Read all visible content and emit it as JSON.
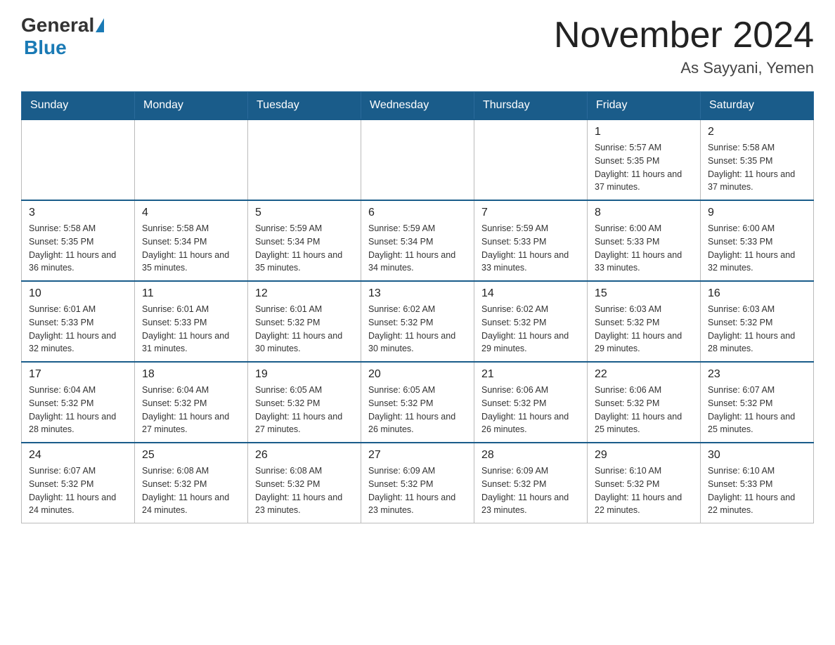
{
  "header": {
    "logo_general": "General",
    "logo_blue": "Blue",
    "month_title": "November 2024",
    "location": "As Sayyani, Yemen"
  },
  "days_of_week": [
    "Sunday",
    "Monday",
    "Tuesday",
    "Wednesday",
    "Thursday",
    "Friday",
    "Saturday"
  ],
  "weeks": [
    {
      "days": [
        {
          "num": "",
          "info": ""
        },
        {
          "num": "",
          "info": ""
        },
        {
          "num": "",
          "info": ""
        },
        {
          "num": "",
          "info": ""
        },
        {
          "num": "",
          "info": ""
        },
        {
          "num": "1",
          "info": "Sunrise: 5:57 AM\nSunset: 5:35 PM\nDaylight: 11 hours and 37 minutes."
        },
        {
          "num": "2",
          "info": "Sunrise: 5:58 AM\nSunset: 5:35 PM\nDaylight: 11 hours and 37 minutes."
        }
      ]
    },
    {
      "days": [
        {
          "num": "3",
          "info": "Sunrise: 5:58 AM\nSunset: 5:35 PM\nDaylight: 11 hours and 36 minutes."
        },
        {
          "num": "4",
          "info": "Sunrise: 5:58 AM\nSunset: 5:34 PM\nDaylight: 11 hours and 35 minutes."
        },
        {
          "num": "5",
          "info": "Sunrise: 5:59 AM\nSunset: 5:34 PM\nDaylight: 11 hours and 35 minutes."
        },
        {
          "num": "6",
          "info": "Sunrise: 5:59 AM\nSunset: 5:34 PM\nDaylight: 11 hours and 34 minutes."
        },
        {
          "num": "7",
          "info": "Sunrise: 5:59 AM\nSunset: 5:33 PM\nDaylight: 11 hours and 33 minutes."
        },
        {
          "num": "8",
          "info": "Sunrise: 6:00 AM\nSunset: 5:33 PM\nDaylight: 11 hours and 33 minutes."
        },
        {
          "num": "9",
          "info": "Sunrise: 6:00 AM\nSunset: 5:33 PM\nDaylight: 11 hours and 32 minutes."
        }
      ]
    },
    {
      "days": [
        {
          "num": "10",
          "info": "Sunrise: 6:01 AM\nSunset: 5:33 PM\nDaylight: 11 hours and 32 minutes."
        },
        {
          "num": "11",
          "info": "Sunrise: 6:01 AM\nSunset: 5:33 PM\nDaylight: 11 hours and 31 minutes."
        },
        {
          "num": "12",
          "info": "Sunrise: 6:01 AM\nSunset: 5:32 PM\nDaylight: 11 hours and 30 minutes."
        },
        {
          "num": "13",
          "info": "Sunrise: 6:02 AM\nSunset: 5:32 PM\nDaylight: 11 hours and 30 minutes."
        },
        {
          "num": "14",
          "info": "Sunrise: 6:02 AM\nSunset: 5:32 PM\nDaylight: 11 hours and 29 minutes."
        },
        {
          "num": "15",
          "info": "Sunrise: 6:03 AM\nSunset: 5:32 PM\nDaylight: 11 hours and 29 minutes."
        },
        {
          "num": "16",
          "info": "Sunrise: 6:03 AM\nSunset: 5:32 PM\nDaylight: 11 hours and 28 minutes."
        }
      ]
    },
    {
      "days": [
        {
          "num": "17",
          "info": "Sunrise: 6:04 AM\nSunset: 5:32 PM\nDaylight: 11 hours and 28 minutes."
        },
        {
          "num": "18",
          "info": "Sunrise: 6:04 AM\nSunset: 5:32 PM\nDaylight: 11 hours and 27 minutes."
        },
        {
          "num": "19",
          "info": "Sunrise: 6:05 AM\nSunset: 5:32 PM\nDaylight: 11 hours and 27 minutes."
        },
        {
          "num": "20",
          "info": "Sunrise: 6:05 AM\nSunset: 5:32 PM\nDaylight: 11 hours and 26 minutes."
        },
        {
          "num": "21",
          "info": "Sunrise: 6:06 AM\nSunset: 5:32 PM\nDaylight: 11 hours and 26 minutes."
        },
        {
          "num": "22",
          "info": "Sunrise: 6:06 AM\nSunset: 5:32 PM\nDaylight: 11 hours and 25 minutes."
        },
        {
          "num": "23",
          "info": "Sunrise: 6:07 AM\nSunset: 5:32 PM\nDaylight: 11 hours and 25 minutes."
        }
      ]
    },
    {
      "days": [
        {
          "num": "24",
          "info": "Sunrise: 6:07 AM\nSunset: 5:32 PM\nDaylight: 11 hours and 24 minutes."
        },
        {
          "num": "25",
          "info": "Sunrise: 6:08 AM\nSunset: 5:32 PM\nDaylight: 11 hours and 24 minutes."
        },
        {
          "num": "26",
          "info": "Sunrise: 6:08 AM\nSunset: 5:32 PM\nDaylight: 11 hours and 23 minutes."
        },
        {
          "num": "27",
          "info": "Sunrise: 6:09 AM\nSunset: 5:32 PM\nDaylight: 11 hours and 23 minutes."
        },
        {
          "num": "28",
          "info": "Sunrise: 6:09 AM\nSunset: 5:32 PM\nDaylight: 11 hours and 23 minutes."
        },
        {
          "num": "29",
          "info": "Sunrise: 6:10 AM\nSunset: 5:32 PM\nDaylight: 11 hours and 22 minutes."
        },
        {
          "num": "30",
          "info": "Sunrise: 6:10 AM\nSunset: 5:33 PM\nDaylight: 11 hours and 22 minutes."
        }
      ]
    }
  ]
}
